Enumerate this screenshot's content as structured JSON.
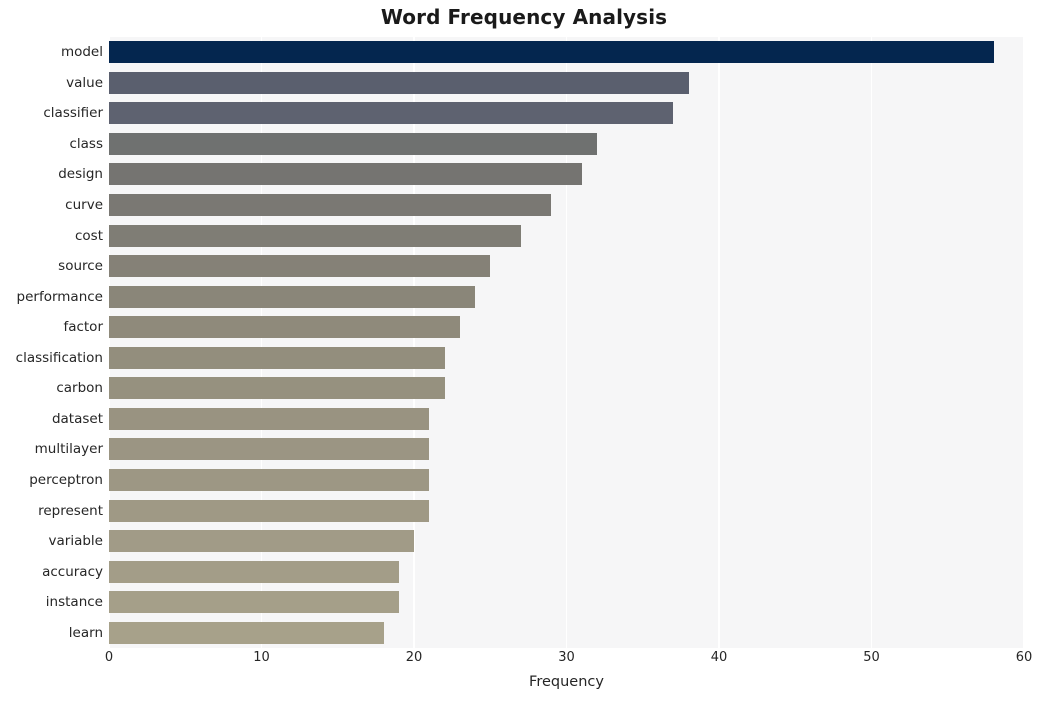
{
  "chart_data": {
    "type": "bar",
    "orientation": "horizontal",
    "title": "Word Frequency Analysis",
    "xlabel": "Frequency",
    "ylabel": "",
    "categories": [
      "model",
      "value",
      "classifier",
      "class",
      "design",
      "curve",
      "cost",
      "source",
      "performance",
      "factor",
      "classification",
      "carbon",
      "dataset",
      "multilayer",
      "perceptron",
      "represent",
      "variable",
      "accuracy",
      "instance",
      "learn"
    ],
    "values": [
      58,
      38,
      37,
      32,
      31,
      29,
      27,
      25,
      24,
      23,
      22,
      22,
      21,
      21,
      21,
      21,
      20,
      19,
      19,
      18
    ],
    "bar_colors": [
      "#04264f",
      "#5a5f6e",
      "#5e6270",
      "#6f7170",
      "#757471",
      "#7a7873",
      "#7f7d75",
      "#858177",
      "#8a8679",
      "#8f8a7b",
      "#938e7d",
      "#96917f",
      "#999381",
      "#9b9583",
      "#9d9784",
      "#9f9985",
      "#a19b87",
      "#a39d88",
      "#a59f89",
      "#a7a18a"
    ],
    "xlim": [
      0,
      60
    ],
    "ylim_count": 20,
    "xticks": [
      "0",
      "10",
      "20",
      "30",
      "40",
      "50",
      "60"
    ],
    "xtick_values": [
      0,
      10,
      20,
      30,
      40,
      50,
      60
    ],
    "grid": {
      "vertical": true,
      "horizontal": false,
      "color": "#ffffff"
    },
    "legend": null,
    "plot_background": "#f6f6f7",
    "figure_background": "#ffffff",
    "style": "whitegrid"
  }
}
